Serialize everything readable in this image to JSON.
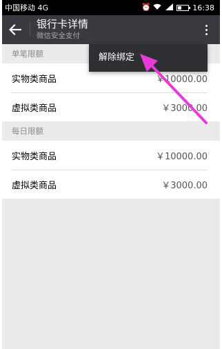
{
  "status_bar": {
    "carrier": "中国移动 4G",
    "time": "16:38"
  },
  "header": {
    "title": "银行卡详情",
    "subtitle": "微信安全支付"
  },
  "menu": {
    "unbind_label": "解除绑定"
  },
  "sections": [
    {
      "title": "单笔限额",
      "rows": [
        {
          "label": "实物类商品",
          "value": "￥10000.00"
        },
        {
          "label": "虚拟类商品",
          "value": "￥3000.00"
        }
      ]
    },
    {
      "title": "每日限额",
      "rows": [
        {
          "label": "实物类商品",
          "value": "￥10000.00"
        },
        {
          "label": "虚拟类商品",
          "value": "￥3000.00"
        }
      ]
    }
  ],
  "colors": {
    "header_bg": "#393a3f",
    "menu_bg": "#2e2f33",
    "page_bg": "#ebebeb",
    "annotation_arrow": "#e63bd8"
  },
  "icons": {
    "back": "arrow-left-icon",
    "more": "more-vertical-icon",
    "alarm": "alarm-icon",
    "wifi": "wifi-icon",
    "signal": "signal-icon",
    "battery": "battery-icon"
  }
}
